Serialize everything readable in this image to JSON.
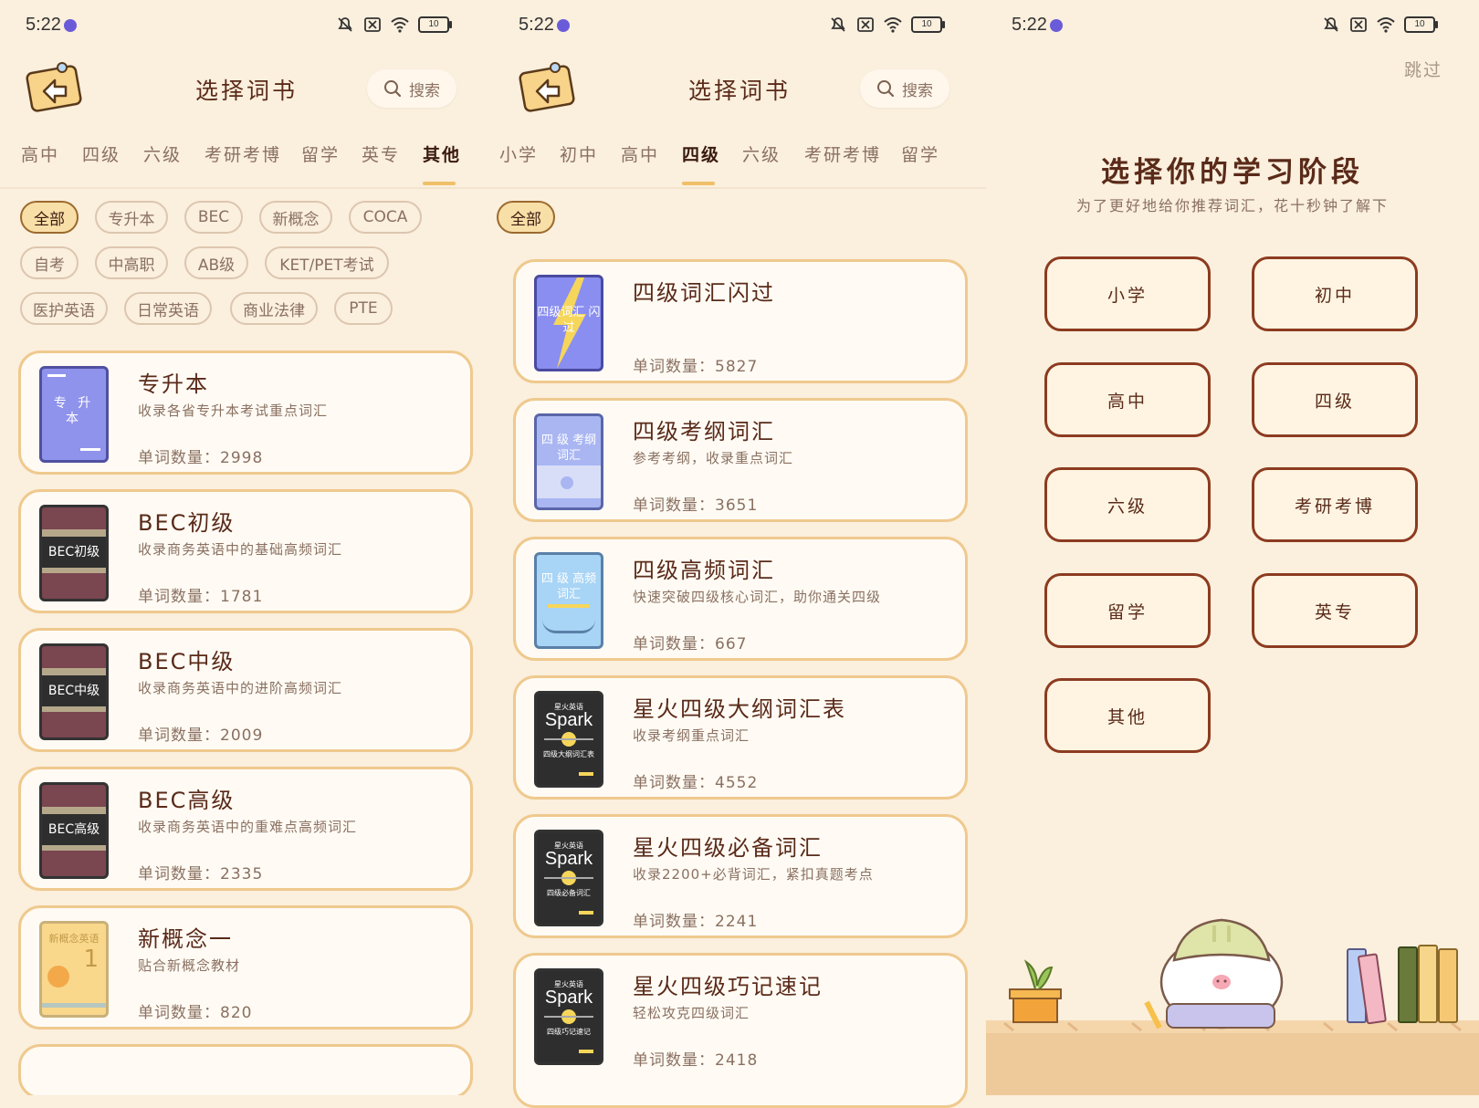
{
  "status": {
    "time": "5:22",
    "battery": "10"
  },
  "screen1": {
    "title": "选择词书",
    "search_label": "搜索",
    "tabs": [
      "高中",
      "四级",
      "六级",
      "考研考博",
      "留学",
      "英专",
      "其他"
    ],
    "active_tab": "其他",
    "chips": [
      "全部",
      "专升本",
      "BEC",
      "新概念",
      "COCA",
      "自考",
      "中高职",
      "AB级",
      "KET/PET考试",
      "医护英语",
      "日常英语",
      "商业法律",
      "PTE"
    ],
    "active_chip": "全部",
    "books": [
      {
        "title": "专升本",
        "desc": "收录各省专升本考试重点词汇",
        "count": "单词数量：2998",
        "cover_text": "专 升 本",
        "cover_color": "#8f93ec"
      },
      {
        "title": "BEC初级",
        "desc": "收录商务英语中的基础高频词汇",
        "count": "单词数量：1781",
        "cover_text": "BEC初级",
        "cover_color": "#7a4650"
      },
      {
        "title": "BEC中级",
        "desc": "收录商务英语中的进阶高频词汇",
        "count": "单词数量：2009",
        "cover_text": "BEC中级",
        "cover_color": "#7a4650"
      },
      {
        "title": "BEC高级",
        "desc": "收录商务英语中的重难点高频词汇",
        "count": "单词数量：2335",
        "cover_text": "BEC高级",
        "cover_color": "#7a4650"
      },
      {
        "title": "新概念一",
        "desc": "贴合新概念教材",
        "count": "单词数量：820",
        "cover_text": "新概念英语",
        "cover_number": "1",
        "cover_color": "#f9d88c"
      }
    ]
  },
  "screen2": {
    "title": "选择词书",
    "search_label": "搜索",
    "tabs": [
      "小学",
      "初中",
      "高中",
      "四级",
      "六级",
      "考研考博",
      "留学"
    ],
    "active_tab": "四级",
    "chips": [
      "全部"
    ],
    "active_chip": "全部",
    "books": [
      {
        "title": "四级词汇闪过",
        "desc": "",
        "count": "单词数量：5827",
        "cover_text": "四级词汇 闪过",
        "cover_color": "#8a8ef0"
      },
      {
        "title": "四级考纲词汇",
        "desc": "参考考纲，收录重点词汇",
        "count": "单词数量：3651",
        "cover_text": "四 级 考纲词汇",
        "cover_color": "#a9b6f2"
      },
      {
        "title": "四级高频词汇",
        "desc": "快速突破四级核心词汇，助你通关四级",
        "count": "单词数量：667",
        "cover_text": "四 级 高频词汇",
        "cover_color": "#a8d4f5"
      },
      {
        "title": "星火四级大纲词汇表",
        "desc": "收录考纲重点词汇",
        "count": "单词数量：4552",
        "cover_brand": "星火英语",
        "cover_text": "Spark",
        "cover_caption": "四级大纲词汇表",
        "cover_color": "#2e2e2e"
      },
      {
        "title": "星火四级必备词汇",
        "desc": "收录2200+必背词汇，紧扣真题考点",
        "count": "单词数量：2241",
        "cover_brand": "星火英语",
        "cover_text": "Spark",
        "cover_caption": "四级必备词汇",
        "cover_color": "#2e2e2e"
      },
      {
        "title": "星火四级巧记速记",
        "desc": "轻松攻克四级词汇",
        "count": "单词数量：2418",
        "cover_brand": "星火英语",
        "cover_text": "Spark",
        "cover_caption": "四级巧记速记",
        "cover_color": "#2e2e2e"
      }
    ]
  },
  "screen3": {
    "skip": "跳过",
    "title": "选择你的学习阶段",
    "subtitle": "为了更好地给你推荐词汇，花十秒钟了解下",
    "stages": [
      "小学",
      "初中",
      "高中",
      "四级",
      "六级",
      "考研考博",
      "留学",
      "英专",
      "其他"
    ]
  }
}
